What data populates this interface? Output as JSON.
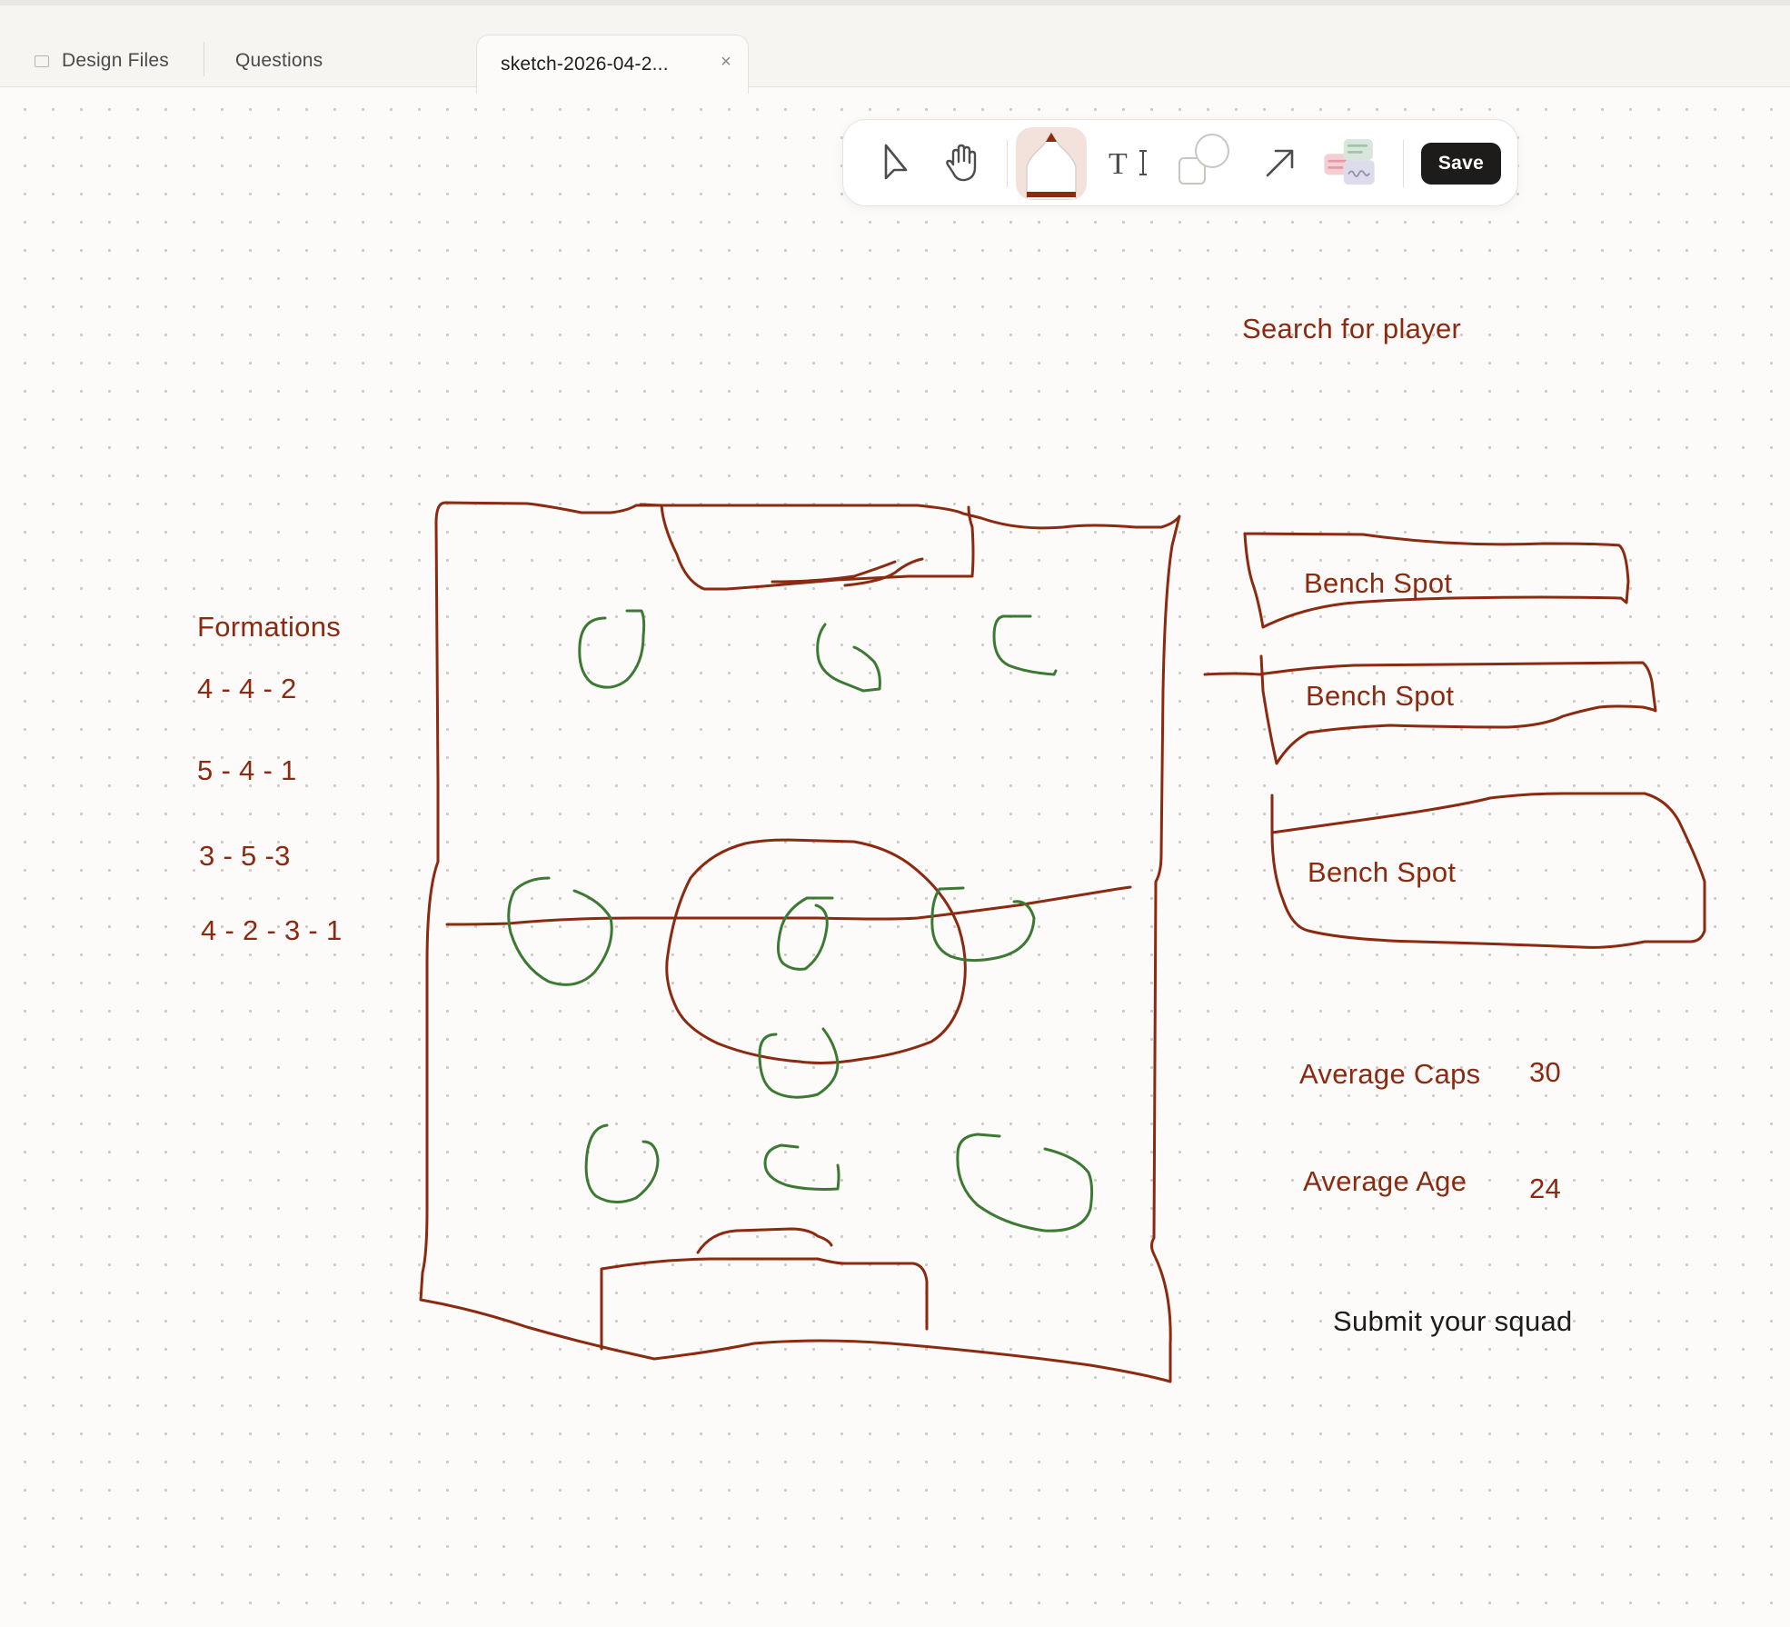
{
  "tabs": {
    "design_files": "Design Files",
    "questions": "Questions",
    "active": "sketch-2026-04-2...",
    "close_icon": "×"
  },
  "toolbar": {
    "save_label": "Save",
    "tools": [
      "select-icon",
      "hand-icon",
      "pen-icon",
      "text-icon",
      "shape-icon",
      "arrow-icon",
      "sticky-note-icon"
    ],
    "active_tool": "pen"
  },
  "canvas": {
    "search_label": "Search for player",
    "formations_title": "Formations",
    "formations": [
      "4 - 4 - 2",
      "5 - 4 - 1",
      "3 - 5 -3",
      "4 - 2 - 3 - 1"
    ],
    "bench_spots": [
      "Bench Spot",
      "Bench Spot",
      "Bench Spot"
    ],
    "average_caps_label": "Average Caps",
    "average_caps_value": "30",
    "average_age_label": "Average Age",
    "average_age_value": "24",
    "submit_label": "Submit your squad"
  },
  "colors": {
    "ink_red": "#8b2a10",
    "ink_green": "#3c7a34",
    "save_bg": "#1d1c1a"
  }
}
